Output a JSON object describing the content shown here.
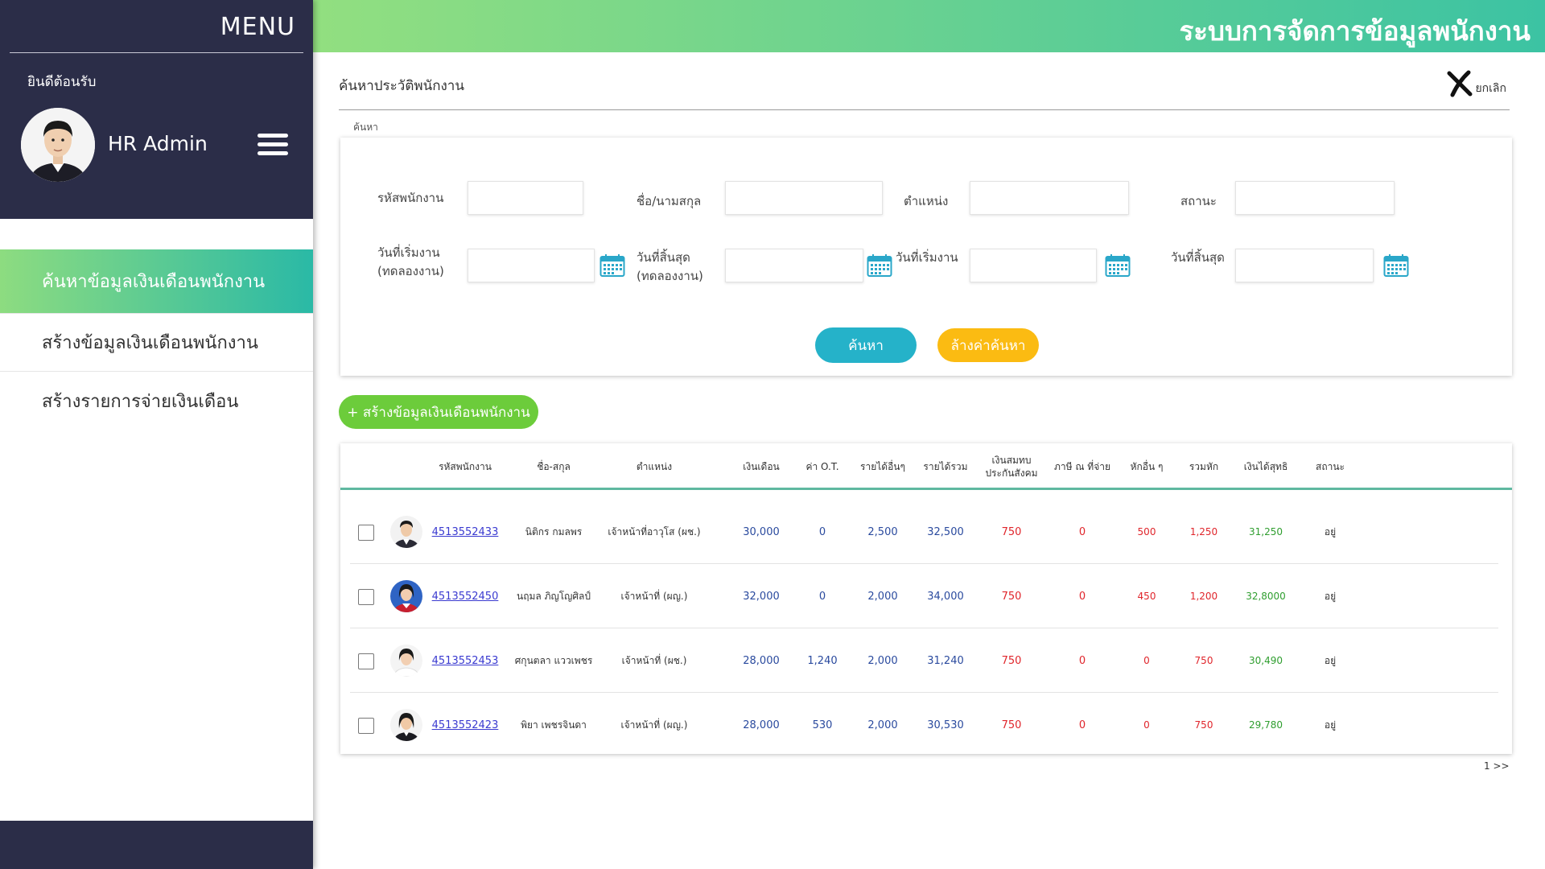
{
  "sidebar": {
    "menu_title": "MENU",
    "welcome": "ยินดีต้อนรับ",
    "user_name": "HR Admin",
    "items": [
      {
        "label": "ค้นหาข้อมูลเงินเดือนพนักงาน"
      },
      {
        "label": "สร้างข้อมูลเงินเดือนพนักงาน"
      },
      {
        "label": "สร้างรายการจ่ายเงินเดือน"
      }
    ]
  },
  "header": {
    "app_title": "ระบบการจัดการข้อมูลพนักงาน"
  },
  "page": {
    "title": "ค้นหาประวัติพนักงาน",
    "cancel_label": "ยกเลิก",
    "search_legend": "ค้นหา"
  },
  "search": {
    "employee_id_label": "รหัสพนักงาน",
    "name_label": "ชื่อ/นามสกุล",
    "position_label": "ตำแหน่ง",
    "status_label": "สถานะ",
    "start_probation_label_1": "วันที่เริ่มงาน",
    "start_probation_label_2": "(ทดลองงาน)",
    "end_probation_label_1": "วันที่สิ้นสุด",
    "end_probation_label_2": "(ทดลองงาน)",
    "start_label": "วันที่เริ่มงาน",
    "end_label": "วันที่สิ้นสุด",
    "search_button": "ค้นหา",
    "clear_button": "ล้างค่าค้นหา"
  },
  "create_button": "+ สร้างข้อมูลเงินเดือนพนักงาน",
  "table": {
    "headers": {
      "id": "รหัสพนักงาน",
      "name": "ชื่อ-สกุล",
      "position": "ตำแหน่ง",
      "salary": "เงินเดือน",
      "ot": "ค่า O.T.",
      "other_income": "รายได้อื่นๆ",
      "total_income": "รายได้รวม",
      "social_1": "เงินสมทบ",
      "social_2": "ประกันสังคม",
      "tax": "ภาษี ณ ที่จ่าย",
      "other_deduct": "หักอื่น ๆ",
      "total_deduct": "รวมหัก",
      "net": "เงินได้สุทธิ",
      "status": "สถานะ"
    },
    "rows": [
      {
        "id": "4513552433",
        "name": "นิติกร  กมลพร",
        "position": "เจ้าหน้าที่อาวุโส (ผช.)",
        "salary": "30,000",
        "ot": "0",
        "other_income": "2,500",
        "total_income": "32,500",
        "social": "750",
        "tax": "0",
        "other_deduct": "500",
        "total_deduct": "1,250",
        "net": "31,250",
        "status": "อยู่"
      },
      {
        "id": "4513552450",
        "name": "นฤมล  ภิญโญศิลป์",
        "position": "เจ้าหน้าที่ (ผญ.)",
        "salary": "32,000",
        "ot": "0",
        "other_income": "2,000",
        "total_income": "34,000",
        "social": "750",
        "tax": "0",
        "other_deduct": "450",
        "total_deduct": "1,200",
        "net": "32,8000",
        "status": "อยู่"
      },
      {
        "id": "4513552453",
        "name": "ศกุนตลา  แววเพชร",
        "position": "เจ้าหน้าที่ (ผช.)",
        "salary": "28,000",
        "ot": "1,240",
        "other_income": "2,000",
        "total_income": "31,240",
        "social": "750",
        "tax": "0",
        "other_deduct": "0",
        "total_deduct": "750",
        "net": "30,490",
        "status": "อยู่"
      },
      {
        "id": "4513552423",
        "name": "พิยา  เพชรจินดา",
        "position": "เจ้าหน้าที่ (ผญ.)",
        "salary": "28,000",
        "ot": "530",
        "other_income": "2,000",
        "total_income": "30,530",
        "social": "750",
        "tax": "0",
        "other_deduct": "0",
        "total_deduct": "750",
        "net": "29,780",
        "status": "อยู่"
      }
    ]
  },
  "pagination": "1 >>",
  "colors": {
    "sidebar_bg": "#2b2d48",
    "accent_green": "#6ccc3b",
    "search_button": "#25b2c9",
    "clear_button": "#fbbb12",
    "deduction_red": "#e0252b",
    "net_green": "#2f9e2f"
  }
}
